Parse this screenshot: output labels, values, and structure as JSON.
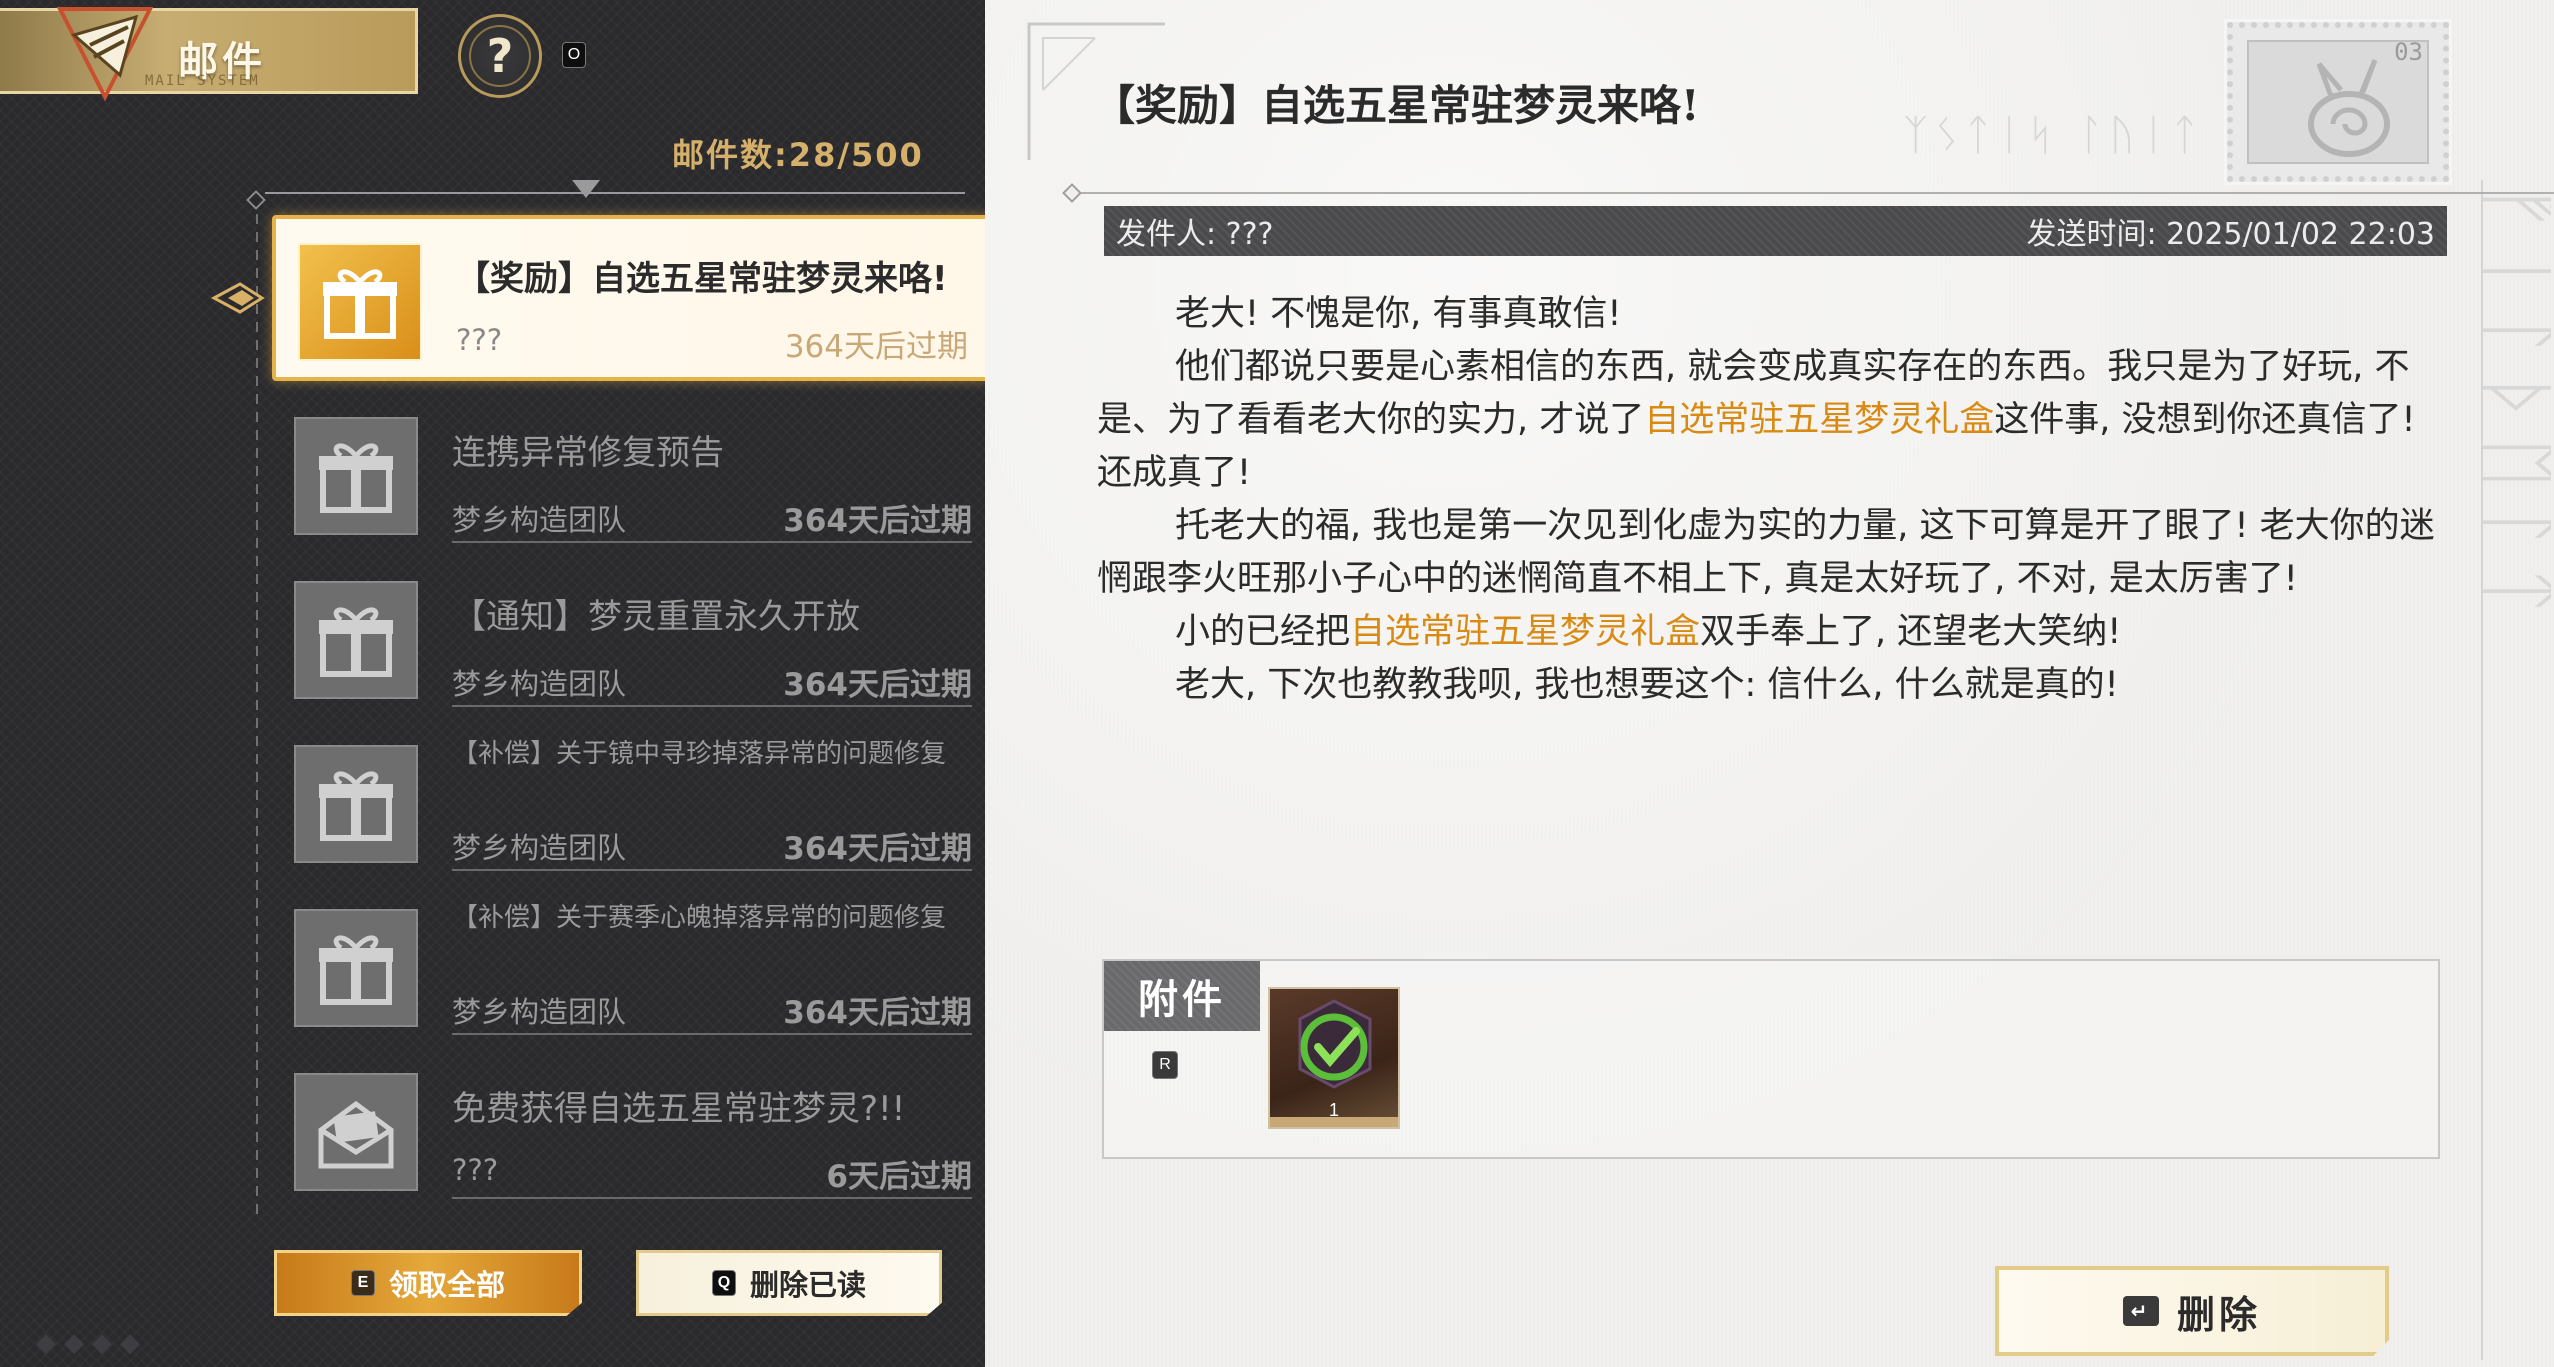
{
  "header": {
    "title": "邮件",
    "subtitle": "MAIL SYSTEM",
    "help_icon": "?",
    "help_key": "O"
  },
  "mail_count": "邮件数:28/500",
  "mail_list": [
    {
      "subject": "【奖励】自选五星常驻梦灵来咯!",
      "sender": "???",
      "expire": "364天后过期",
      "icon": "gift-box-icon",
      "selected": true
    },
    {
      "subject": "连携异常修复预告",
      "sender": "梦乡构造团队",
      "expire": "364天后过期",
      "icon": "gift-box-icon",
      "selected": false
    },
    {
      "subject": "【通知】梦灵重置永久开放",
      "sender": "梦乡构造团队",
      "expire": "364天后过期",
      "icon": "gift-box-icon",
      "selected": false
    },
    {
      "subject": "【补偿】关于镜中寻珍掉落异常的问题修复",
      "sender": "梦乡构造团队",
      "expire": "364天后过期",
      "icon": "gift-box-icon",
      "selected": false
    },
    {
      "subject": "【补偿】关于赛季心魄掉落异常的问题修复",
      "sender": "梦乡构造团队",
      "expire": "364天后过期",
      "icon": "gift-box-icon",
      "selected": false
    },
    {
      "subject": "免费获得自选五星常驻梦灵?!!",
      "sender": "???",
      "expire": "6天后过期",
      "icon": "open-envelope-icon",
      "selected": false
    }
  ],
  "buttons": {
    "claim_all": "领取全部",
    "claim_all_key": "E",
    "delete_read": "删除已读",
    "delete_read_key": "Q",
    "delete": "删除"
  },
  "detail": {
    "title": "【奖励】自选五星常驻梦灵来咯!",
    "stamp_number": "03",
    "sender_label": "发件人: ???",
    "time_label": "发送时间:  2025/01/02 22:03",
    "body": {
      "p1": "老大! 不愧是你, 有事真敢信!",
      "p2a": "他们都说只要是心素相信的东西, 就会变成真实存在的东西。我只是为了好玩, 不是、为了看看老大你的实力, 才说了",
      "p2_highlight": "自选常驻五星梦灵礼盒",
      "p2b": "这件事, 没想到你还真信了! 还成真了!",
      "p3": "托老大的福, 我也是第一次见到化虚为实的力量, 这下可算是开了眼了! 老大你的迷惘跟李火旺那小子心中的迷惘简直不相上下, 真是太好玩了, 不对, 是太厉害了!",
      "p4a": "小的已经把",
      "p4_highlight": "自选常驻五星梦灵礼盒",
      "p4b": "双手奉上了, 还望老大笑纳!",
      "p5": "老大, 下次也教教我呗, 我也想要这个: 信什么, 什么就是真的!"
    },
    "attachment": {
      "label": "附件",
      "key": "R",
      "item_count": "1",
      "item_icon": "selection-box-icon"
    }
  },
  "colors": {
    "accent_gold": "#e6b24a",
    "highlight_orange": "#d88a12",
    "dark_panel": "#2a2a2d",
    "paper": "#f0efed"
  }
}
